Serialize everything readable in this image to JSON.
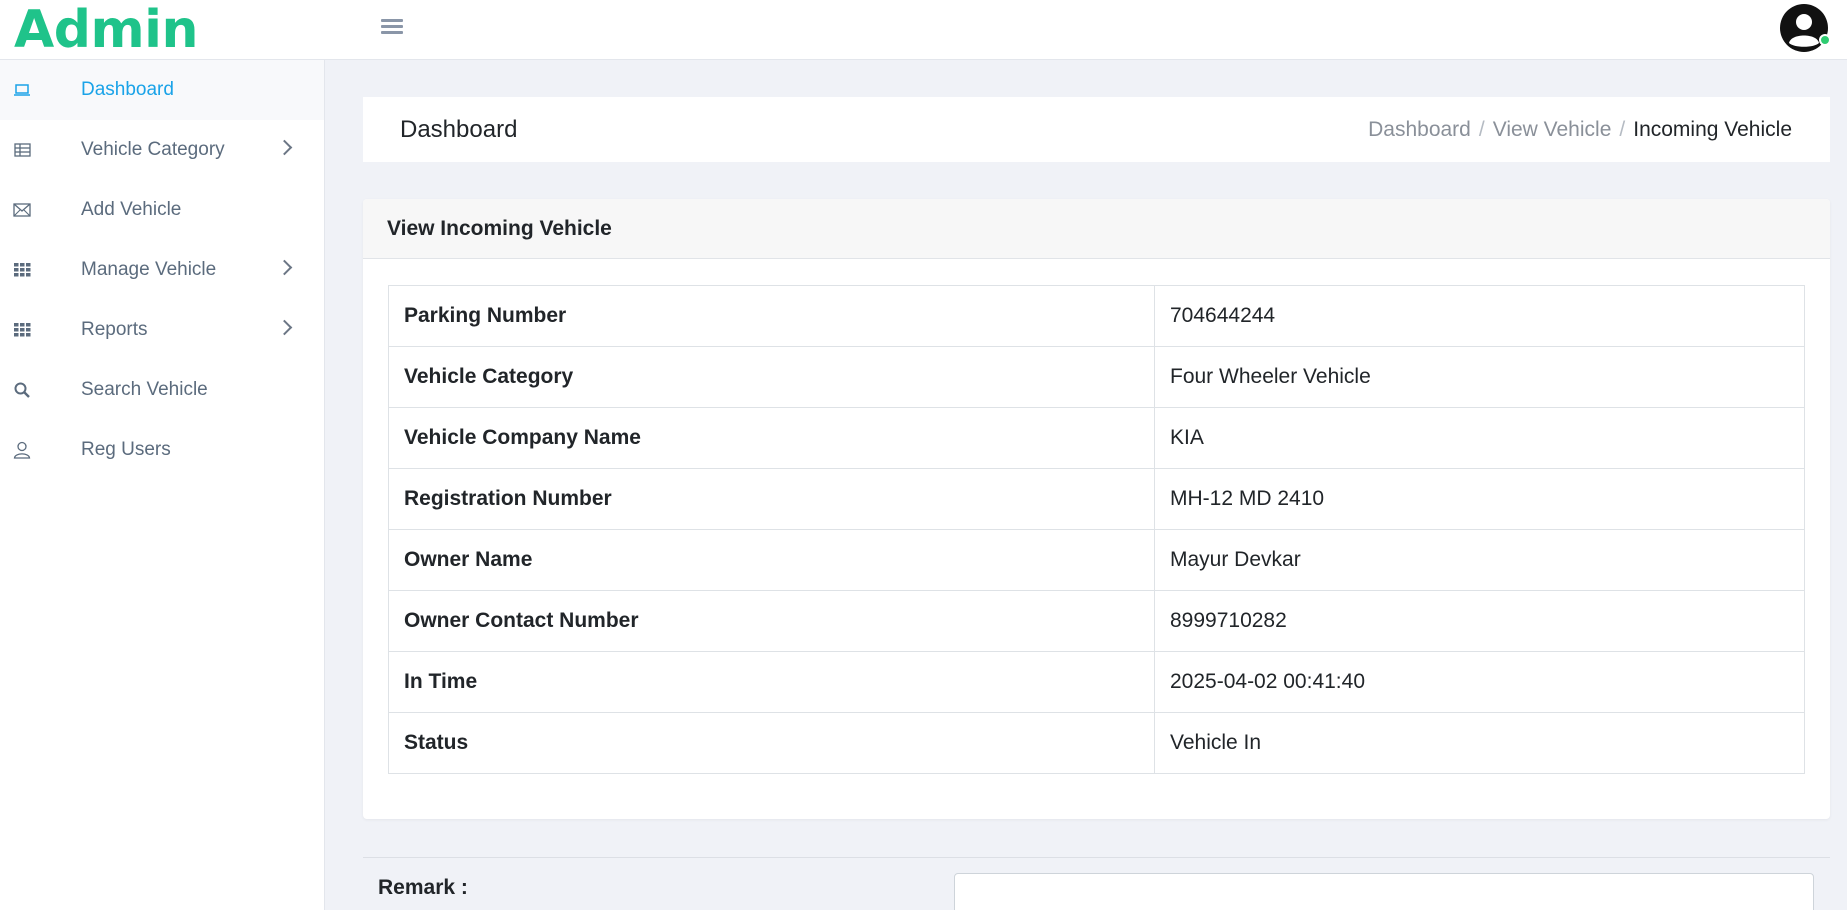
{
  "brand": {
    "title": "Admin",
    "color": "#1fc38a"
  },
  "sidebar": {
    "items": [
      {
        "label": "Dashboard",
        "icon": "laptop-icon",
        "active": true
      },
      {
        "label": "Vehicle Category",
        "icon": "table-icon",
        "has_submenu": true
      },
      {
        "label": "Add Vehicle",
        "icon": "envelope-icon"
      },
      {
        "label": "Manage Vehicle",
        "icon": "grid-icon",
        "has_submenu": true
      },
      {
        "label": "Reports",
        "icon": "grid-icon",
        "has_submenu": true
      },
      {
        "label": "Search Vehicle",
        "icon": "search-icon"
      },
      {
        "label": "Reg Users",
        "icon": "user-icon"
      }
    ]
  },
  "header": {
    "page_title": "Dashboard",
    "breadcrumb": [
      "Dashboard",
      "View Vehicle",
      "Incoming Vehicle"
    ]
  },
  "card": {
    "title": "View Incoming Vehicle",
    "rows": [
      {
        "label": "Parking Number",
        "value": "704644244"
      },
      {
        "label": "Vehicle Category",
        "value": "Four Wheeler Vehicle"
      },
      {
        "label": "Vehicle Company Name",
        "value": "KIA"
      },
      {
        "label": "Registration Number",
        "value": "MH-12 MD 2410"
      },
      {
        "label": "Owner Name",
        "value": "Mayur Devkar"
      },
      {
        "label": "Owner Contact Number",
        "value": "8999710282"
      },
      {
        "label": "In Time",
        "value": "2025-04-02 00:41:40"
      },
      {
        "label": "Status",
        "value": "Vehicle In"
      }
    ]
  },
  "remark": {
    "label": "Remark :",
    "value": ""
  },
  "colors": {
    "active_link": "#1aa3e8",
    "status_online": "#2ecc71"
  }
}
